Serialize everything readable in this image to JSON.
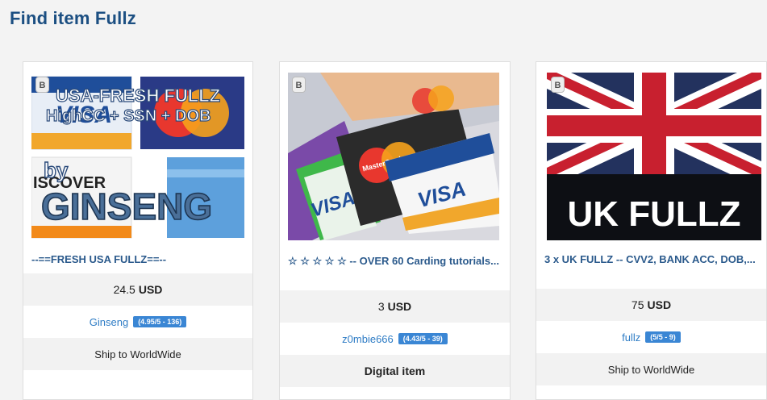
{
  "page": {
    "title": "Find item Fullz"
  },
  "listings": [
    {
      "image_text": {
        "line1": "USA-FRESH FULLZ",
        "line2": "HighCC + SSN + DOB",
        "by": "by",
        "brand": "GINSENG",
        "discover": "ISCOVER"
      },
      "corner_badge": "B",
      "title": "--==FRESH USA FULLZ==--",
      "price": {
        "value": "24.5",
        "currency": "USD"
      },
      "seller": {
        "name": "Ginseng",
        "rating": "(4.95/5 - 136)"
      },
      "shipping": "Ship to WorldWide"
    },
    {
      "image_text": {
        "visa1": "VISA",
        "visa2": "VISA",
        "mastercard": "MasterCard"
      },
      "corner_badge": "B",
      "title": "☆ ☆ ☆ ☆ ☆ -- OVER 60 Carding tutorials...",
      "price": {
        "value": "3",
        "currency": "USD"
      },
      "seller": {
        "name": "z0mbie666",
        "rating": "(4.43/5 - 39)"
      },
      "shipping": "Digital item"
    },
    {
      "image_text": {
        "caption": "UK FULLZ"
      },
      "corner_badge": "B",
      "title": "3 x UK FULLZ -- CVV2, BANK ACC, DOB,...",
      "price": {
        "value": "75",
        "currency": "USD"
      },
      "seller": {
        "name": "fullz",
        "rating": "(5/5 - 9)"
      },
      "shipping": "Ship to WorldWide"
    }
  ],
  "colors": {
    "title": "#1c4f82",
    "link": "#2e7cc5",
    "badge": "#3a86d4",
    "card_border": "#dedede",
    "band_gray": "#f2f2f2"
  }
}
